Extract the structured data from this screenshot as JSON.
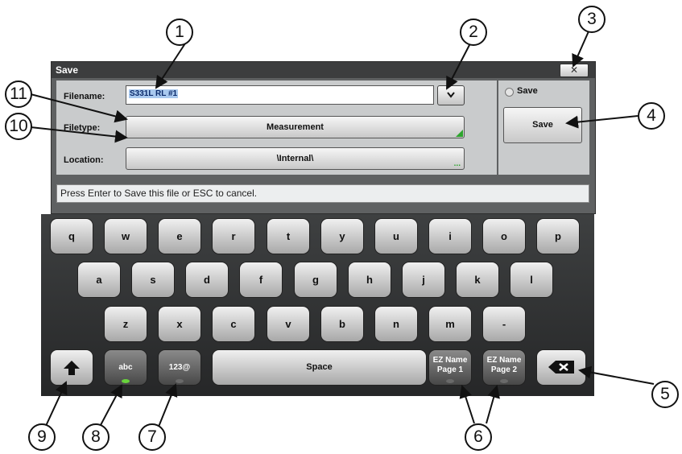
{
  "dialog": {
    "title": "Save",
    "close_label": "✕",
    "filename_label": "Filename:",
    "filename_value": "S331L RL #1",
    "filetype_label": "Filetype:",
    "filetype_value": "Measurement",
    "location_label": "Location:",
    "location_value": "\\Internal\\",
    "save_option_label": "Save",
    "save_button_label": "Save",
    "status_message": "Press Enter to Save this file or ESC to cancel."
  },
  "keyboard": {
    "row1": [
      "q",
      "w",
      "e",
      "r",
      "t",
      "y",
      "u",
      "i",
      "o",
      "p"
    ],
    "row2": [
      "a",
      "s",
      "d",
      "f",
      "g",
      "h",
      "j",
      "k",
      "l"
    ],
    "row3": [
      "z",
      "x",
      "c",
      "v",
      "b",
      "n",
      "m",
      "-"
    ],
    "abc_label": "abc",
    "num_label": "123@",
    "space_label": "Space",
    "ez1_line1": "EZ Name",
    "ez1_line2": "Page 1",
    "ez2_line1": "EZ Name",
    "ez2_line2": "Page 2",
    "icons": [
      "shift-icon",
      "backspace-icon",
      "chevron-down-icon",
      "close-icon"
    ]
  },
  "callouts": [
    "1",
    "2",
    "3",
    "4",
    "5",
    "6",
    "7",
    "8",
    "9",
    "10",
    "11"
  ],
  "colors": {
    "selection": "#a9c9ef",
    "indicator_on": "#69d33c",
    "indicator_green": "#2ea52e"
  }
}
